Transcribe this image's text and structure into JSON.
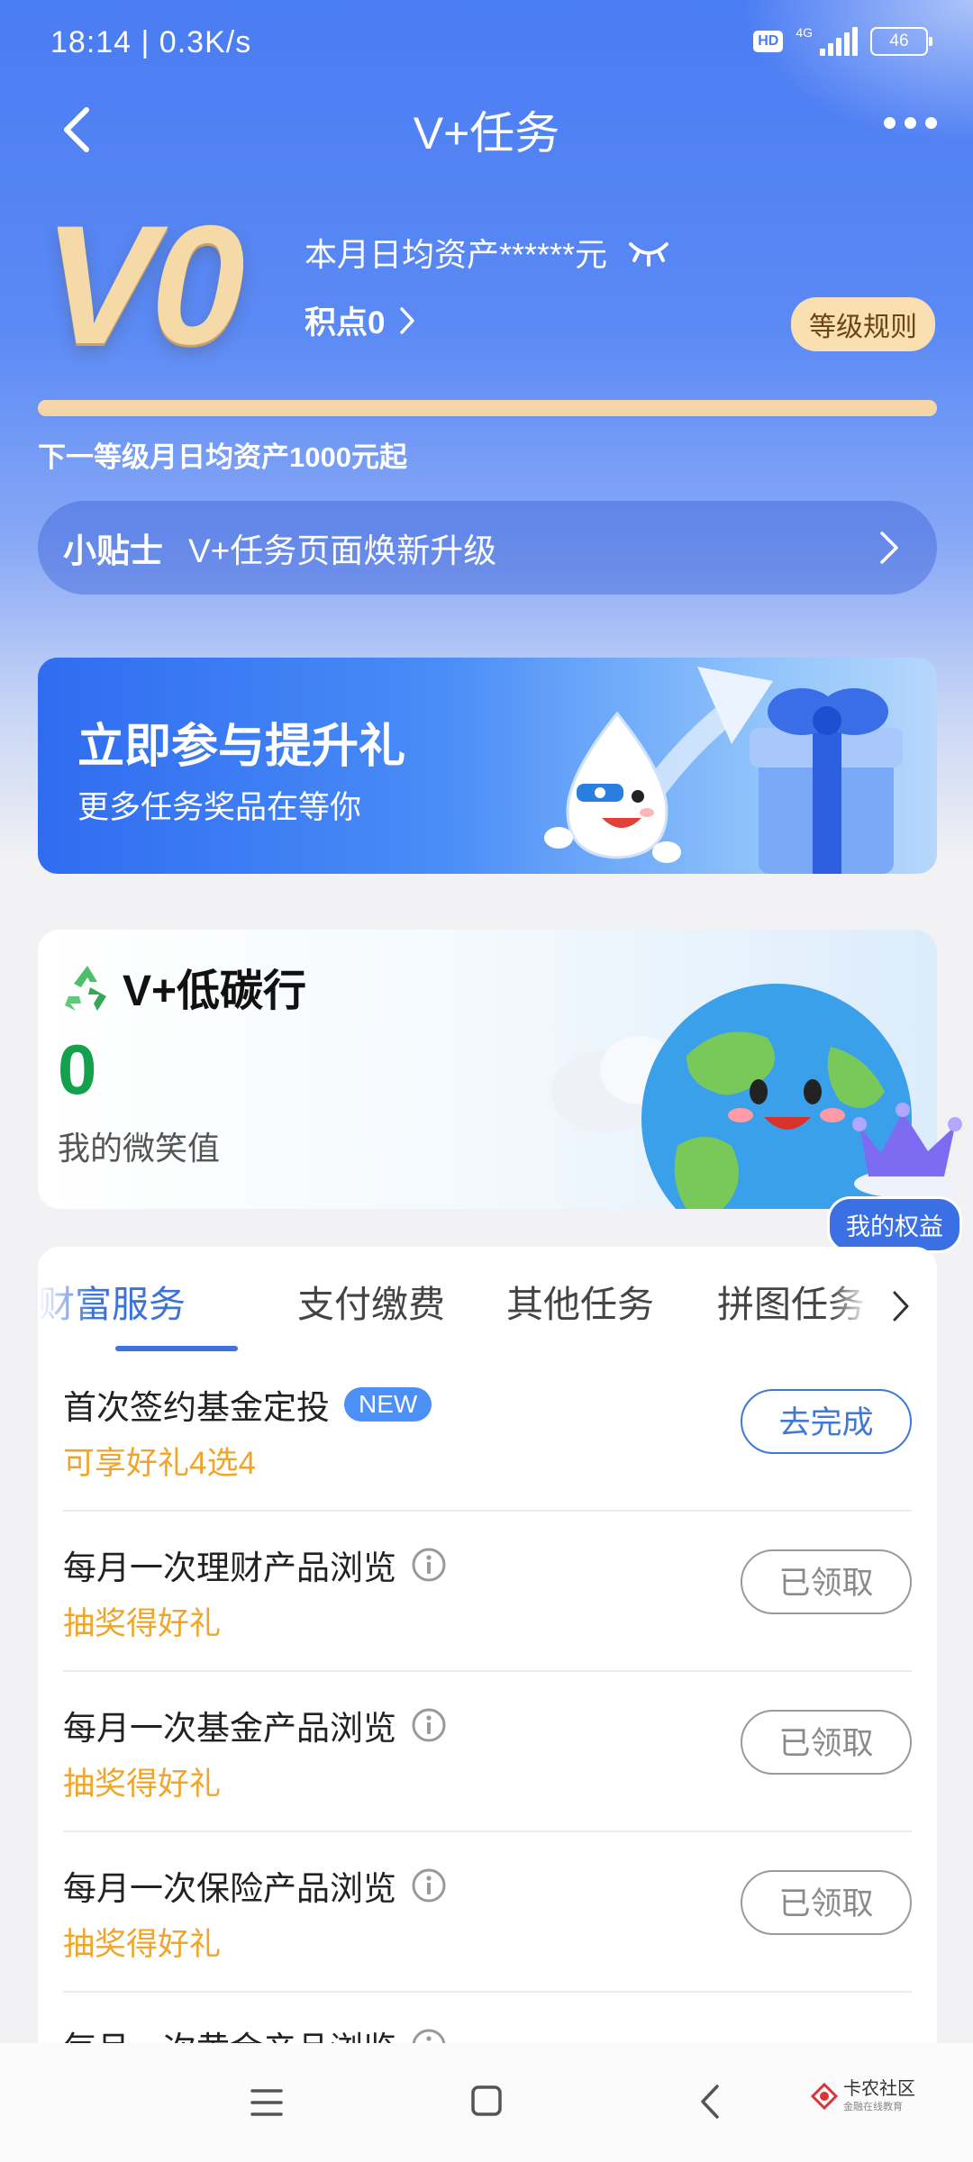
{
  "status_bar": {
    "time_speed": "18:14 | 0.3K/s",
    "hd": "HD",
    "network": "4G",
    "battery": "46"
  },
  "nav": {
    "title": "V+任务"
  },
  "level": {
    "badge": "V0",
    "asset_text": "本月日均资产******元",
    "points": "积点0",
    "rules_label": "等级规则",
    "progress_fraction": 1.0,
    "next_level_text": "下一等级月日均资产1000元起"
  },
  "tip": {
    "tag": "小贴士",
    "text": "V+任务页面焕新升级"
  },
  "banner": {
    "title": "立即参与提升礼",
    "subtitle": "更多任务奖品在等你"
  },
  "carbon": {
    "title": "V+低碳行",
    "value": "0",
    "label": "我的微笑值",
    "benefit_button": "我的权益"
  },
  "tabs": [
    {
      "label": "财富服务",
      "active": true
    },
    {
      "label": "支付缴费",
      "active": false
    },
    {
      "label": "其他任务",
      "active": false
    },
    {
      "label": "拼图任务",
      "active": false
    }
  ],
  "tasks": [
    {
      "title": "首次签约基金定投",
      "badge": "NEW",
      "reward": "可享好礼4选4",
      "button": "去完成",
      "state": "todo",
      "info": false
    },
    {
      "title": "每月一次理财产品浏览",
      "badge": "",
      "reward": "抽奖得好礼",
      "button": "已领取",
      "state": "done",
      "info": true
    },
    {
      "title": "每月一次基金产品浏览",
      "badge": "",
      "reward": "抽奖得好礼",
      "button": "已领取",
      "state": "done",
      "info": true
    },
    {
      "title": "每月一次保险产品浏览",
      "badge": "",
      "reward": "抽奖得好礼",
      "button": "已领取",
      "state": "done",
      "info": true
    },
    {
      "title": "每月一次黄金产品浏览",
      "badge": "",
      "reward": "",
      "button": "",
      "state": "done",
      "info": true
    }
  ],
  "watermark": {
    "name": "卡农社区",
    "sub": "金融在线教育"
  },
  "colors": {
    "primary_blue": "#4a7cf3",
    "gold": "#f5d6a6",
    "reward_orange": "#f0a52a",
    "carbon_green": "#14a14e"
  }
}
